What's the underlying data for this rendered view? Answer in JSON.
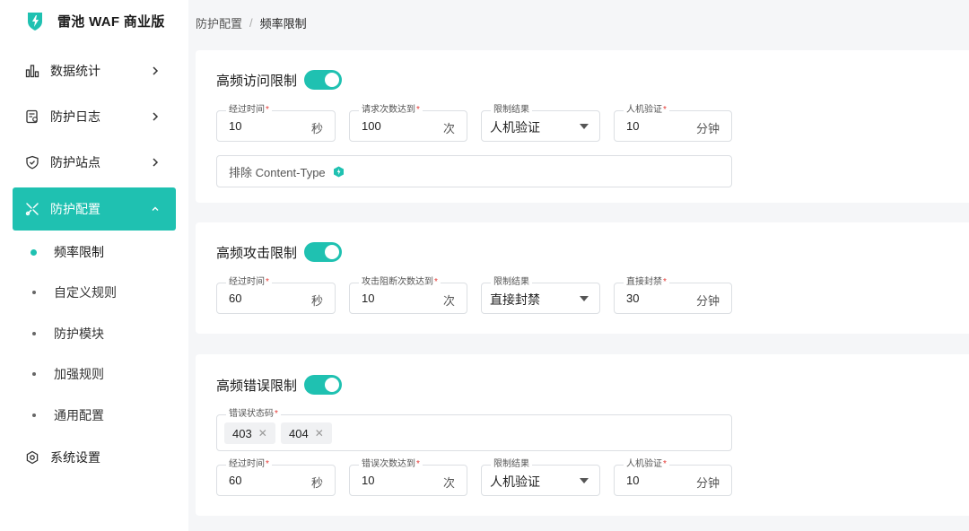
{
  "brand": {
    "title": "雷池 WAF 商业版"
  },
  "breadcrumb": {
    "parent": "防护配置",
    "separator": "/",
    "current": "频率限制"
  },
  "sidebar": {
    "items": [
      {
        "label": "数据统计",
        "icon": "bar-chart-icon"
      },
      {
        "label": "防护日志",
        "icon": "log-icon"
      },
      {
        "label": "防护站点",
        "icon": "shield-icon"
      },
      {
        "label": "防护配置",
        "icon": "tools-icon"
      },
      {
        "label": "系统设置",
        "icon": "gear-icon"
      }
    ],
    "sub_items": [
      {
        "label": "频率限制"
      },
      {
        "label": "自定义规则"
      },
      {
        "label": "防护模块"
      },
      {
        "label": "加强规则"
      },
      {
        "label": "通用配置"
      }
    ]
  },
  "cards": [
    {
      "title": "高频访问限制",
      "enabled": true,
      "fields": [
        {
          "label": "经过时间",
          "value": "10",
          "suffix": "秒"
        },
        {
          "label": "请求次数达到",
          "value": "100",
          "suffix": "次"
        },
        {
          "label": "限制结果",
          "value": "人机验证"
        },
        {
          "label": "人机验证",
          "value": "10",
          "suffix": "分钟"
        }
      ],
      "exclude_label": "排除 Content-Type"
    },
    {
      "title": "高频攻击限制",
      "enabled": true,
      "fields": [
        {
          "label": "经过时间",
          "value": "60",
          "suffix": "秒"
        },
        {
          "label": "攻击阻断次数达到",
          "value": "10",
          "suffix": "次"
        },
        {
          "label": "限制结果",
          "value": "直接封禁"
        },
        {
          "label": "直接封禁",
          "value": "30",
          "suffix": "分钟"
        }
      ]
    },
    {
      "title": "高频错误限制",
      "enabled": true,
      "status_codes_label": "错误状态码",
      "status_codes": [
        "403",
        "404"
      ],
      "fields": [
        {
          "label": "经过时间",
          "value": "60",
          "suffix": "秒"
        },
        {
          "label": "错误次数达到",
          "value": "10",
          "suffix": "次"
        },
        {
          "label": "限制结果",
          "value": "人机验证"
        },
        {
          "label": "人机验证",
          "value": "10",
          "suffix": "分钟"
        }
      ]
    }
  ],
  "colors": {
    "accent": "#1fc1b1",
    "required": "#e53935"
  }
}
